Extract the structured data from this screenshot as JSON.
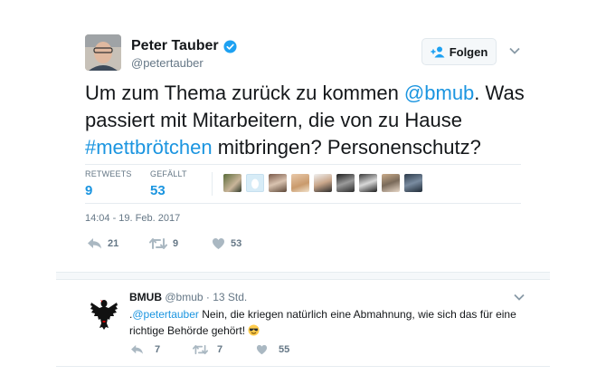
{
  "tweet": {
    "author_name": "Peter Tauber",
    "author_handle": "@petertauber",
    "follow_label": "Folgen",
    "text_1": "Um zum Thema zurück zu kommen ",
    "mention": "@bmub",
    "text_2": ". Was passiert mit Mitarbeitern, die von zu Hause ",
    "hashtag": "#mettbrötchen",
    "text_3": " mitbringen? Personenschutz?",
    "stats": {
      "retweets_label": "RETWEETS",
      "retweets": "9",
      "likes_label": "GEFÄLLT",
      "likes": "53"
    },
    "timestamp": "14:04 - 19. Feb. 2017",
    "actions": {
      "replies": "21",
      "retweets": "9",
      "likes": "53"
    }
  },
  "reply": {
    "author_name": "BMUB",
    "author_handle": "@bmub",
    "age": "13 Std.",
    "prefix": ".",
    "mention": "@petertauber",
    "text": " Nein, die kriegen natürlich eine Abmahnung, wie sich das für eine richtige Behörde gehört!",
    "actions": {
      "replies": "7",
      "retweets": "7",
      "likes": "55"
    }
  },
  "colors": {
    "link": "#1b95e0",
    "muted": "#657786",
    "border": "#e6ecf0"
  }
}
